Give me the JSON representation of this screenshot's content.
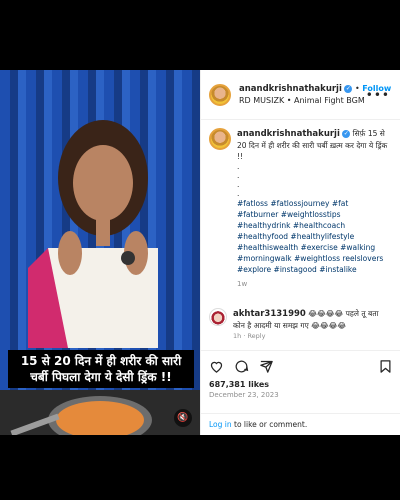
{
  "post": {
    "username": "anandkrishnathakurji",
    "follow_label": "Follow",
    "dot": "•",
    "subtitle": "RD MUSIZK • Animal Fight BGM",
    "more_label": "•••",
    "caption_first": "सिर्फ़ 15 से 20 दिन में ही शरीर की सारी चर्बी ख़त्म कर देगा ये ड्रिंक !!",
    "caption_dots": ".\n.\n.\n.",
    "hashtags": "#fatloss #fatlossjourney #fat #fatburner #weightlosstips #healthydrink #healthcoach #healthyfood #healthylifestyle #healthiswealth #exercise #walking #morningwalk #weightloss reelslovers #explore #instagood #instalike",
    "time_ago": "1w",
    "likes": "687,381 likes",
    "date": "December 23, 2023",
    "login_link": "Log in",
    "login_rest": " to like or comment."
  },
  "video": {
    "overlay_text": "15 से 20 दिन में ही शरीर की सारी चर्बी पिघला देगा ये देसी ड्रिंक !!",
    "mute_icon": "speaker-muted-icon"
  },
  "comment": {
    "username": "akhtar3131990",
    "text": "😂😂😂😂 पहले तू बता कोन है आदमी या समझ गए 😂😂😂😂",
    "meta": "1h  ·  Reply"
  },
  "colors": {
    "accent": "#0095f6",
    "verified": "#3897f0",
    "link": "#00376b"
  }
}
